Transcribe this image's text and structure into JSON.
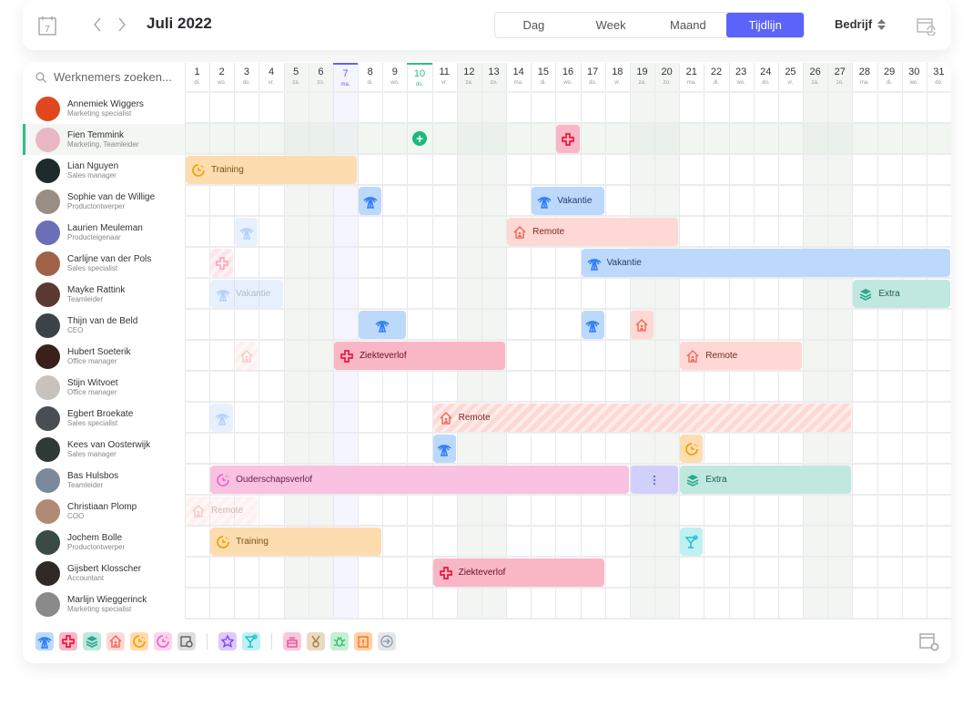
{
  "header": {
    "title": "Juli 2022",
    "calendar_day": "7",
    "views": [
      "Dag",
      "Week",
      "Maand",
      "Tijdlijn"
    ],
    "active_view": "Tijdlijn",
    "company_label": "Bedrijf"
  },
  "sidebar": {
    "search_placeholder": "Werknemers zoeken...",
    "employees": [
      {
        "name": "Annemiek Wiggers",
        "role": "Marketing specialist",
        "avatar": "#e0471f"
      },
      {
        "name": "Fien Temmink",
        "role": "Marketing, Teamleider",
        "avatar": "#eab7c4",
        "selected": true
      },
      {
        "name": "Lian Nguyen",
        "role": "Sales manager",
        "avatar": "#1e2a2e"
      },
      {
        "name": "Sophie van de Willige",
        "role": "Productontwerper",
        "avatar": "#9a8d84"
      },
      {
        "name": "Laurien Meuleman",
        "role": "Producteigenaar",
        "avatar": "#6a6fb6"
      },
      {
        "name": "Carlijne van der Pols",
        "role": "Sales specialist",
        "avatar": "#a0634a"
      },
      {
        "name": "Mayke Rattink",
        "role": "Teamleider",
        "avatar": "#5a3a30"
      },
      {
        "name": "Thijn van de Beld",
        "role": "CEO",
        "avatar": "#3c4248"
      },
      {
        "name": "Hubert Soeterik",
        "role": "Office manager",
        "avatar": "#3a1f1a"
      },
      {
        "name": "Stijn Witvoet",
        "role": "Office manager",
        "avatar": "#c9c2bc"
      },
      {
        "name": "Egbert Broekate",
        "role": "Sales specialist",
        "avatar": "#4a4e52"
      },
      {
        "name": "Kees van Oosterwijk",
        "role": "Sales manager",
        "avatar": "#2e3a36"
      },
      {
        "name": "Bas Hulsbos",
        "role": "Teamleider",
        "avatar": "#7a8a9a"
      },
      {
        "name": "Christiaan Plomp",
        "role": "COO",
        "avatar": "#b08a74"
      },
      {
        "name": "Jochem Bolle",
        "role": "Productontwerper",
        "avatar": "#3a4a44"
      },
      {
        "name": "Gijsbert Klosscher",
        "role": "Accountant",
        "avatar": "#2f2a28"
      },
      {
        "name": "Marlijn Wieggerinck",
        "role": "Marketing specialist",
        "avatar": "#8a8a8a"
      }
    ]
  },
  "days": [
    [
      "1",
      "di."
    ],
    [
      "2",
      "wo."
    ],
    [
      "3",
      "do."
    ],
    [
      "4",
      "vr."
    ],
    [
      "5",
      "za."
    ],
    [
      "6",
      "zo."
    ],
    [
      "7",
      "ma."
    ],
    [
      "8",
      "di."
    ],
    [
      "9",
      "wo."
    ],
    [
      "10",
      "do."
    ],
    [
      "11",
      "vr."
    ],
    [
      "12",
      "za."
    ],
    [
      "13",
      "zo."
    ],
    [
      "14",
      "ma."
    ],
    [
      "15",
      "di."
    ],
    [
      "16",
      "wo."
    ],
    [
      "17",
      "do."
    ],
    [
      "18",
      "vr."
    ],
    [
      "19",
      "za."
    ],
    [
      "20",
      "zo."
    ],
    [
      "21",
      "ma."
    ],
    [
      "22",
      "di."
    ],
    [
      "23",
      "wo."
    ],
    [
      "24",
      "do."
    ],
    [
      "25",
      "vr."
    ],
    [
      "26",
      "za."
    ],
    [
      "27",
      "zo."
    ],
    [
      "28",
      "ma."
    ],
    [
      "29",
      "di."
    ],
    [
      "30",
      "wo."
    ],
    [
      "31",
      "do."
    ]
  ],
  "weekend_days": [
    5,
    6,
    12,
    13,
    19,
    20,
    26,
    27
  ],
  "today_day": 7,
  "current_day": 10,
  "types": {
    "vacation": {
      "bg": "#bcd9fb",
      "fg": "#2f7ef5",
      "text": "#1f3d6b",
      "icon": "palm-tree"
    },
    "sick": {
      "bg": "#f9b7c5",
      "fg": "#e8173f",
      "text": "#6b0f20",
      "icon": "medical-cross"
    },
    "extra": {
      "bg": "#c0e8e0",
      "fg": "#2aa88e",
      "text": "#1d5c50",
      "icon": "layers"
    },
    "remote": {
      "bg": "#fdd8d4",
      "fg": "#f06a5c",
      "text": "#7a2a22",
      "icon": "house"
    },
    "training": {
      "bg": "#fddcb0",
      "fg": "#f5a000",
      "text": "#7a5010",
      "icon": "clock"
    },
    "parental": {
      "bg": "#f9c2e0",
      "fg": "#e26ad0",
      "text": "#6a1a50",
      "icon": "clock"
    },
    "more": {
      "bg": "#d1d0fb",
      "fg": "#5b63f8",
      "text": "#333",
      "icon": "more-vertical"
    },
    "drinks": {
      "bg": "#bff0f2",
      "fg": "#1fc0d0",
      "text": "#1d5c60",
      "icon": "cocktail"
    }
  },
  "events": [
    {
      "row": 1,
      "start": 16,
      "end": 16,
      "type": "sick"
    },
    {
      "row": 2,
      "start": 1,
      "end": 7,
      "type": "training",
      "label": "Training"
    },
    {
      "row": 3,
      "start": 8,
      "end": 8,
      "type": "vacation"
    },
    {
      "row": 3,
      "start": 15,
      "end": 17,
      "type": "vacation",
      "label": "Vakantie"
    },
    {
      "row": 4,
      "start": 3,
      "end": 3,
      "type": "vacation",
      "faded": true
    },
    {
      "row": 4,
      "start": 14,
      "end": 20,
      "type": "remote",
      "label": "Remote"
    },
    {
      "row": 5,
      "start": 2,
      "end": 2,
      "type": "sick",
      "faded": true,
      "striped": true
    },
    {
      "row": 5,
      "start": 17,
      "end": 31,
      "type": "vacation",
      "label": "Vakantie"
    },
    {
      "row": 6,
      "start": 2,
      "end": 4,
      "type": "vacation",
      "label": "Vakantie",
      "faded": true
    },
    {
      "row": 6,
      "start": 28,
      "end": 31,
      "type": "extra",
      "label": "Extra"
    },
    {
      "row": 7,
      "start": 8,
      "end": 9,
      "type": "vacation"
    },
    {
      "row": 7,
      "start": 17,
      "end": 17,
      "type": "vacation"
    },
    {
      "row": 7,
      "start": 19,
      "end": 19,
      "type": "remote"
    },
    {
      "row": 8,
      "start": 3,
      "end": 3,
      "type": "remote",
      "faded": true,
      "striped": true
    },
    {
      "row": 8,
      "start": 7,
      "end": 13,
      "type": "sick",
      "label": "Ziekteverlof"
    },
    {
      "row": 8,
      "start": 21,
      "end": 25,
      "type": "remote",
      "label": "Remote"
    },
    {
      "row": 10,
      "start": 2,
      "end": 2,
      "type": "vacation",
      "faded": true
    },
    {
      "row": 10,
      "start": 11,
      "end": 27,
      "type": "remote",
      "label": "Remote",
      "striped": true
    },
    {
      "row": 11,
      "start": 11,
      "end": 11,
      "type": "vacation"
    },
    {
      "row": 11,
      "start": 21,
      "end": 21,
      "type": "training"
    },
    {
      "row": 12,
      "start": 2,
      "end": 18,
      "type": "parental",
      "label": "Ouderschapsverlof"
    },
    {
      "row": 12,
      "start": 19,
      "end": 20,
      "type": "more"
    },
    {
      "row": 12,
      "start": 21,
      "end": 27,
      "type": "extra",
      "label": "Extra"
    },
    {
      "row": 13,
      "start": 1,
      "end": 3,
      "type": "remote",
      "label": "Remote",
      "faded": true,
      "striped": true
    },
    {
      "row": 14,
      "start": 2,
      "end": 8,
      "type": "training",
      "label": "Training"
    },
    {
      "row": 14,
      "start": 21,
      "end": 21,
      "type": "drinks"
    },
    {
      "row": 15,
      "start": 11,
      "end": 17,
      "type": "sick",
      "label": "Ziekteverlof"
    }
  ],
  "add_button": {
    "row": 1,
    "day": 10
  },
  "legend": [
    [
      {
        "icon": "palm-tree",
        "bg": "#bcd9fb",
        "fg": "#2f7ef5"
      },
      {
        "icon": "medical-cross",
        "bg": "#f9b7c5",
        "fg": "#e8173f"
      },
      {
        "icon": "layers",
        "bg": "#c0e8e0",
        "fg": "#2aa88e"
      },
      {
        "icon": "house",
        "bg": "#fdd8d4",
        "fg": "#f06a5c"
      },
      {
        "icon": "clock",
        "bg": "#fddcb0",
        "fg": "#f5a000"
      },
      {
        "icon": "clock",
        "bg": "#fbd4ee",
        "fg": "#e26ad0"
      },
      {
        "icon": "calendar-clock",
        "bg": "#dedede",
        "fg": "#555"
      }
    ],
    [
      {
        "icon": "star",
        "bg": "#dccbfb",
        "fg": "#7b3ff0"
      },
      {
        "icon": "cocktail",
        "bg": "#bff0f2",
        "fg": "#1fc0d0"
      }
    ],
    [
      {
        "icon": "cake",
        "bg": "#fbc8de",
        "fg": "#e84a90"
      },
      {
        "icon": "medal",
        "bg": "#ead9c2",
        "fg": "#a07838"
      },
      {
        "icon": "bug",
        "bg": "#c4f0d4",
        "fg": "#2ab860"
      },
      {
        "icon": "clipboard",
        "bg": "#fdd0a8",
        "fg": "#f07010"
      },
      {
        "icon": "sign-in",
        "bg": "#e4e6ea",
        "fg": "#8890a0"
      }
    ]
  ]
}
